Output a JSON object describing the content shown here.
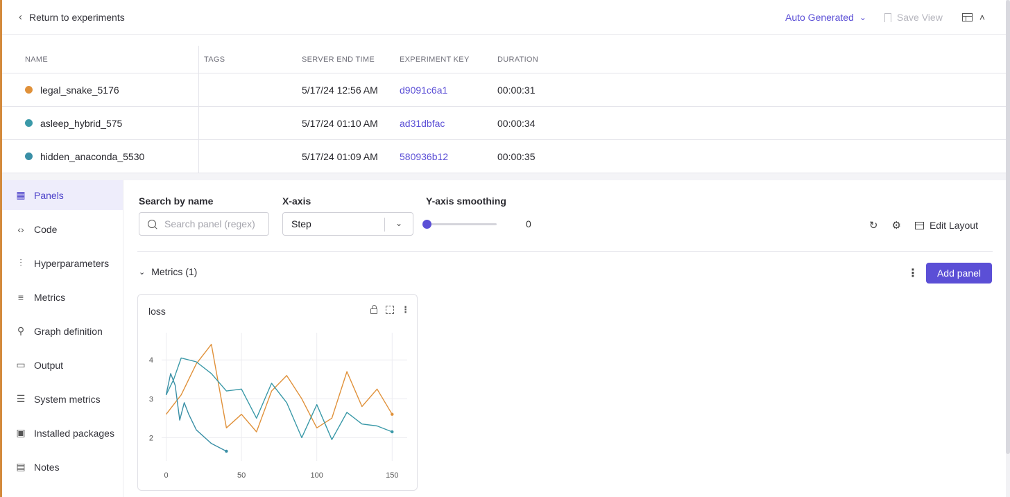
{
  "topbar": {
    "back_label": "Return to experiments",
    "view_label": "Auto Generated",
    "save_view_label": "Save View"
  },
  "experiments": {
    "columns": [
      "NAME",
      "TAGS",
      "SERVER END TIME",
      "EXPERIMENT KEY",
      "DURATION"
    ],
    "rows": [
      {
        "name": "legal_snake_5176",
        "color": "#e0913a",
        "tags": "",
        "end_time": "5/17/24 12:56 AM",
        "key": "d9091c6a1",
        "duration": "00:00:31"
      },
      {
        "name": "asleep_hybrid_575",
        "color": "#3a99a8",
        "tags": "",
        "end_time": "5/17/24 01:10 AM",
        "key": "ad31dbfac",
        "duration": "00:00:34"
      },
      {
        "name": "hidden_anaconda_5530",
        "color": "#3a8fa6",
        "tags": "",
        "end_time": "5/17/24 01:09 AM",
        "key": "580936b12",
        "duration": "00:00:35"
      }
    ]
  },
  "sidebar": {
    "items": [
      {
        "label": "Panels",
        "icon": "grid-icon",
        "active": true
      },
      {
        "label": "Code",
        "icon": "code-icon"
      },
      {
        "label": "Hyperparameters",
        "icon": "sliders-vertical-icon"
      },
      {
        "label": "Metrics",
        "icon": "metrics-lines-icon"
      },
      {
        "label": "Graph definition",
        "icon": "graph-nodes-icon"
      },
      {
        "label": "Output",
        "icon": "terminal-icon"
      },
      {
        "label": "System metrics",
        "icon": "system-lines-icon"
      },
      {
        "label": "Installed packages",
        "icon": "python-package-icon"
      },
      {
        "label": "Notes",
        "icon": "note-icon"
      }
    ]
  },
  "filters": {
    "search_label": "Search by name",
    "search_placeholder": "Search panel (regex)",
    "xaxis_label": "X-axis",
    "xaxis_value": "Step",
    "smoothing_label": "Y-axis smoothing",
    "smoothing_value": "0",
    "edit_layout_label": "Edit Layout"
  },
  "section": {
    "title": "Metrics (1)",
    "add_panel_label": "Add panel"
  },
  "panel": {
    "title": "loss"
  },
  "chart_data": {
    "type": "line",
    "title": "loss",
    "xlabel": "",
    "ylabel": "",
    "xlim": [
      -3,
      160
    ],
    "ylim": [
      1.4,
      4.7
    ],
    "xticks": [
      0,
      50,
      100,
      150
    ],
    "yticks": [
      2,
      3,
      4
    ],
    "grid": true,
    "legend": "none",
    "series": [
      {
        "color": "#e0913a",
        "x": [
          0,
          10,
          20,
          30,
          40,
          50,
          60,
          70,
          80,
          90,
          100,
          110,
          120,
          130,
          140,
          150
        ],
        "y": [
          2.6,
          3.1,
          3.9,
          4.4,
          2.25,
          2.6,
          2.15,
          3.2,
          3.6,
          3.0,
          2.25,
          2.5,
          3.7,
          2.8,
          3.25,
          2.6
        ]
      },
      {
        "color": "#3a99a8",
        "x": [
          0,
          5,
          10,
          20,
          30,
          40,
          50,
          60,
          70,
          80,
          90,
          100,
          110,
          120,
          130,
          140,
          150
        ],
        "y": [
          3.1,
          3.5,
          4.05,
          3.95,
          3.65,
          3.2,
          3.25,
          2.5,
          3.4,
          2.9,
          2.0,
          2.85,
          1.95,
          2.65,
          2.35,
          2.3,
          2.15
        ]
      },
      {
        "color": "#3a8fa6",
        "x": [
          0,
          3,
          6,
          9,
          12,
          15,
          20,
          30,
          40
        ],
        "y": [
          3.1,
          3.65,
          3.35,
          2.45,
          2.9,
          2.6,
          2.2,
          1.85,
          1.65
        ]
      }
    ]
  }
}
